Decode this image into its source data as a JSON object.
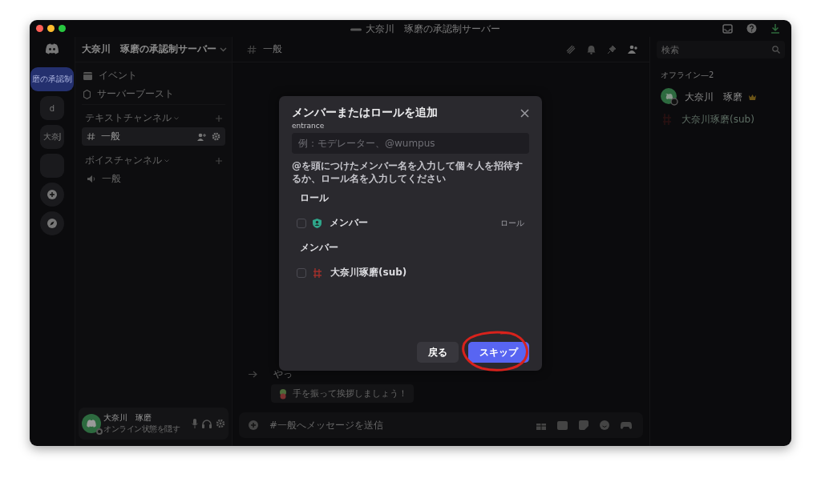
{
  "window": {
    "title": "大奈川　琢磨の承認制サーバー"
  },
  "servers": [
    {
      "label": "磨の承認制",
      "selected": true
    },
    {
      "label": "d",
      "selected": false
    },
    {
      "label": "大奈J",
      "selected": false
    },
    {
      "selected": false
    }
  ],
  "server_header": {
    "name": "大奈川　琢磨の承認制サーバー"
  },
  "shortcuts": [
    {
      "label": "イベント",
      "kind": "event"
    },
    {
      "label": "サーバーブースト",
      "kind": "boost"
    }
  ],
  "categories": [
    {
      "name": "テキストチャンネル",
      "channels": [
        {
          "name": "一般",
          "kind": "text",
          "selected": true
        }
      ]
    },
    {
      "name": "ボイスチャンネル",
      "channels": [
        {
          "name": "一般",
          "kind": "voice",
          "selected": false
        }
      ]
    }
  ],
  "user_panel": {
    "name": "大奈川　琢磨",
    "status": "オンライン状態を隠す"
  },
  "chat": {
    "channel": "一般",
    "message_partial": "やっ",
    "wave_button": "手を振って挨拶しましょう！",
    "composer_placeholder": "#一般へメッセージを送信"
  },
  "search": {
    "placeholder": "検索"
  },
  "members": {
    "heading": "オフライン—2",
    "items": [
      {
        "name": "大奈川　琢磨",
        "owner": true,
        "kind": "avatar"
      },
      {
        "name": "大奈川琢磨(sub)",
        "owner": false,
        "kind": "mark"
      }
    ]
  },
  "dialog": {
    "title": "メンバーまたはロールを追加",
    "field_label": "entrance",
    "placeholder": "例：モデレーター、@wumpus",
    "hint": "@を頭につけたメンバー名を入力して個々人を招待するか、ロール名を入力してください",
    "sections": [
      {
        "heading": "ロール",
        "items": [
          {
            "name": "メンバー",
            "tag": "ロール",
            "kind": "role",
            "checked": false
          }
        ]
      },
      {
        "heading": "メンバー",
        "items": [
          {
            "name": "大奈川琢磨(sub)",
            "kind": "member",
            "checked": false
          }
        ]
      }
    ],
    "buttons": [
      {
        "label": "戻る",
        "kind": "secondary",
        "circled": false
      },
      {
        "label": "スキップ",
        "kind": "primary",
        "circled": true
      }
    ]
  }
}
